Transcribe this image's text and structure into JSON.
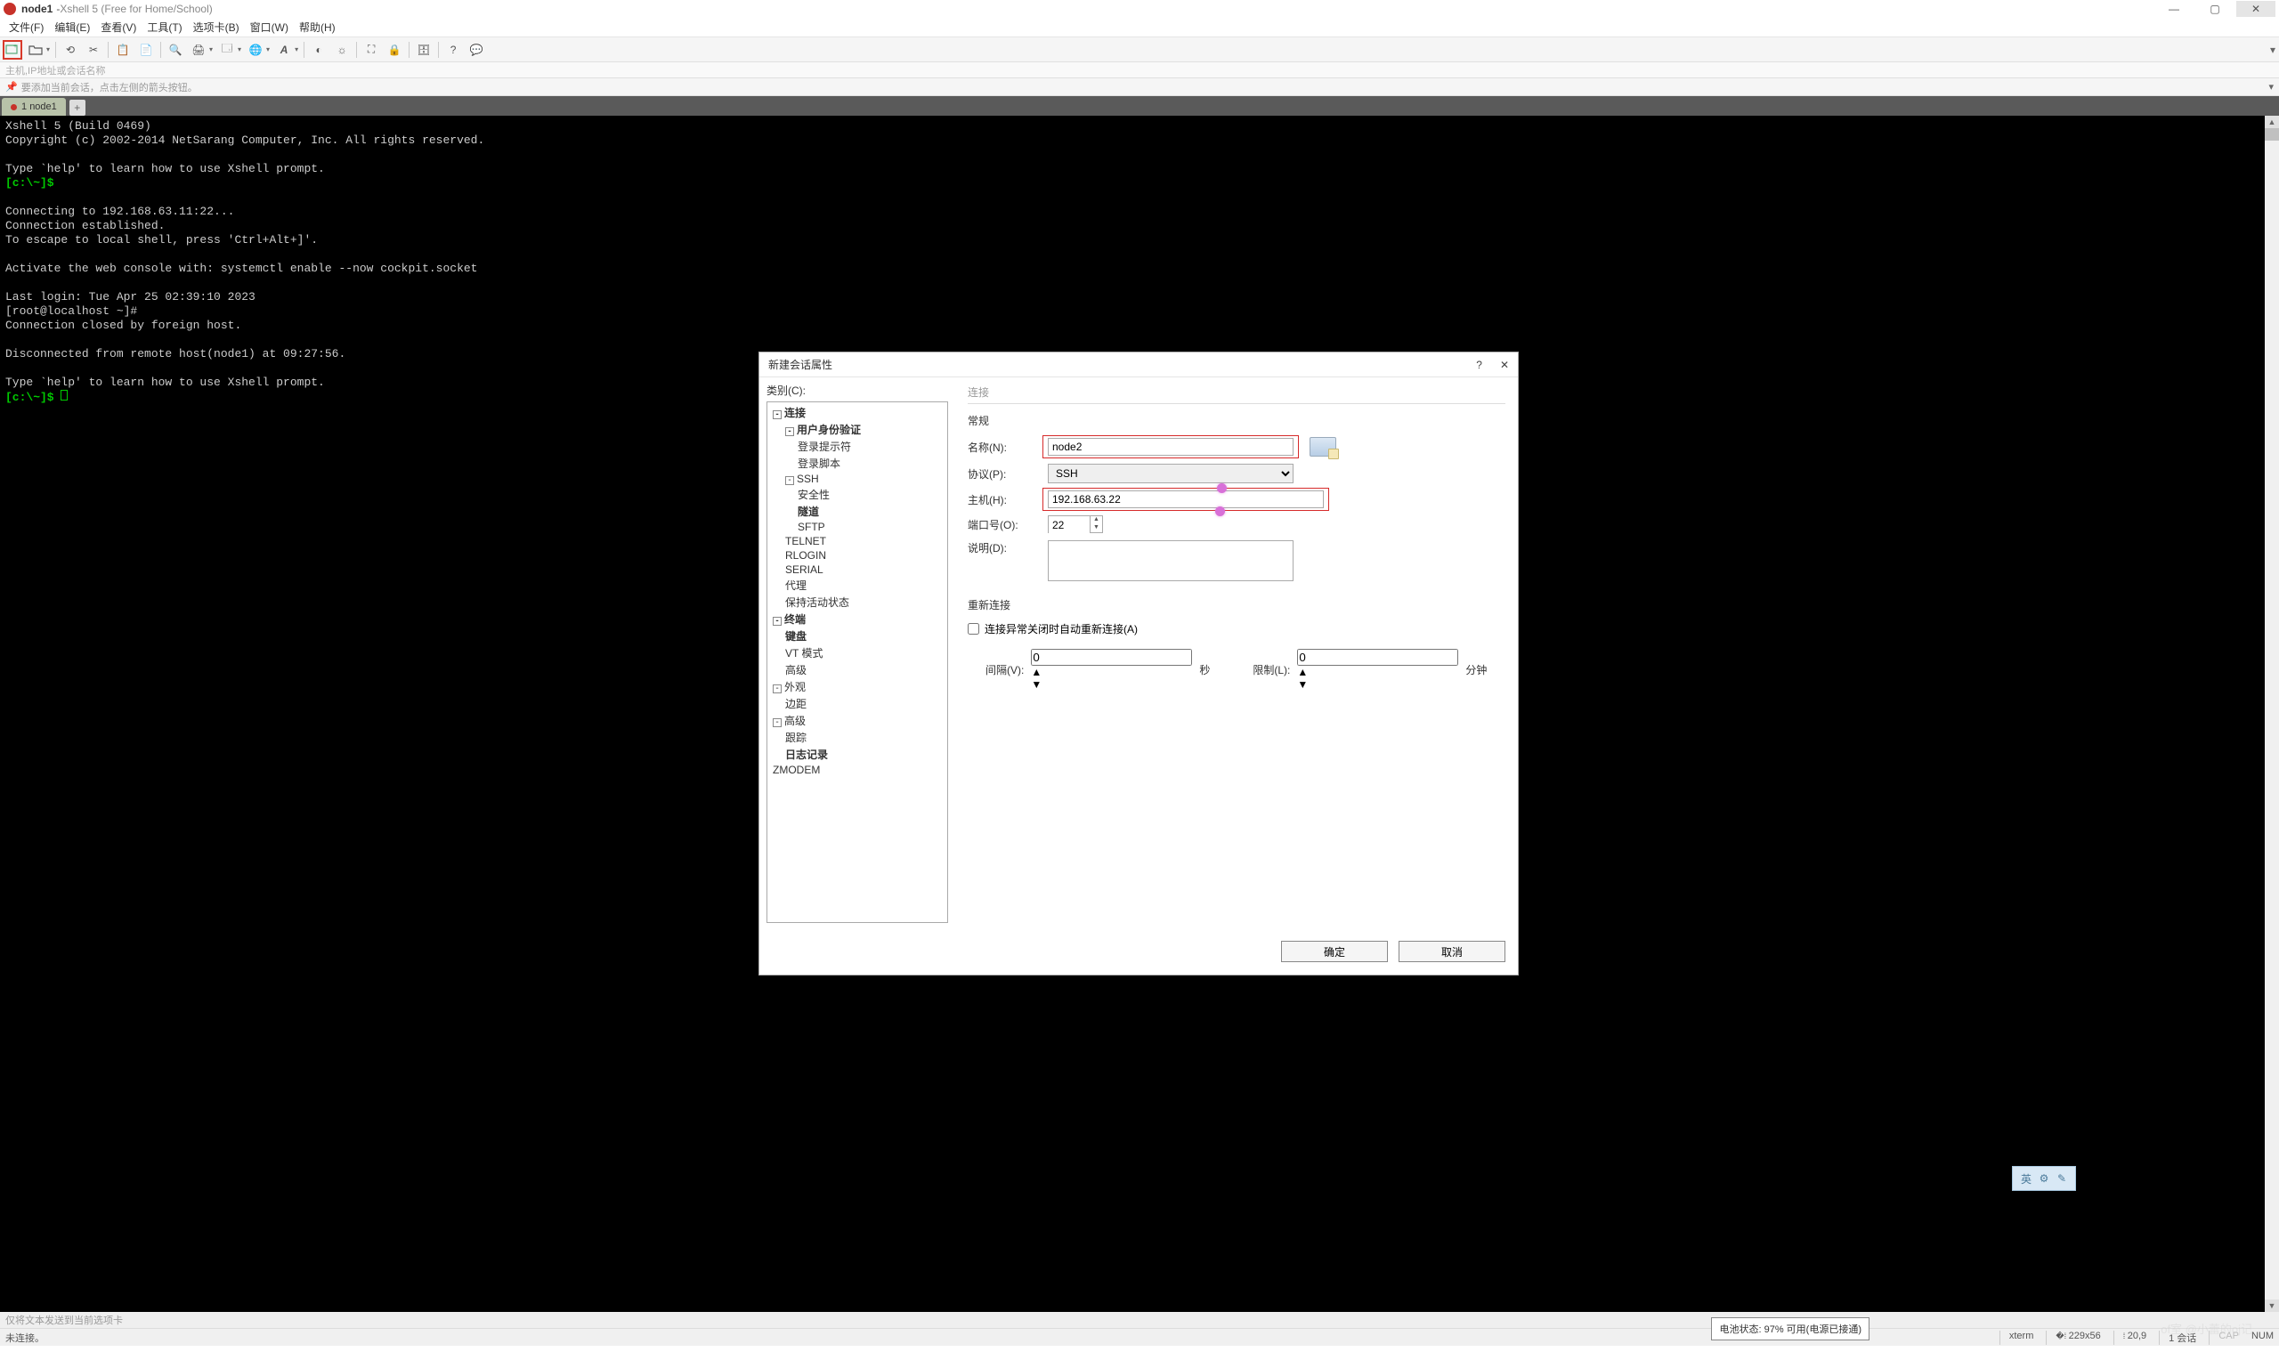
{
  "title": {
    "session": "node1",
    "app": "Xshell 5 (Free for Home/School)"
  },
  "menu": [
    "文件(F)",
    "编辑(E)",
    "查看(V)",
    "工具(T)",
    "选项卡(B)",
    "窗口(W)",
    "帮助(H)"
  ],
  "addressbar_placeholder": "主机,IP地址或会话名称",
  "quickbar_text": "要添加当前会话，点击左侧的箭头按钮。",
  "tab": {
    "index": "1",
    "name": "node1"
  },
  "terminal_lines": [
    "Xshell 5 (Build 0469)",
    "Copyright (c) 2002-2014 NetSarang Computer, Inc. All rights reserved.",
    "",
    "Type `help' to learn how to use Xshell prompt.",
    {
      "prompt": "[c:\\~]$ ",
      "rest": ""
    },
    "",
    "Connecting to 192.168.63.11:22...",
    "Connection established.",
    "To escape to local shell, press 'Ctrl+Alt+]'.",
    "",
    "Activate the web console with: systemctl enable --now cockpit.socket",
    "",
    "Last login: Tue Apr 25 02:39:10 2023",
    "[root@localhost ~]#",
    "Connection closed by foreign host.",
    "",
    "Disconnected from remote host(node1) at 09:27:56.",
    "",
    "Type `help' to learn how to use Xshell prompt.",
    {
      "prompt": "[c:\\~]$ ",
      "rest": "",
      "cursor": true
    }
  ],
  "dialog": {
    "title": "新建会话属性",
    "tree_label": "类别(C):",
    "tree": [
      {
        "l": 0,
        "b": true,
        "e": "-",
        "t": "连接"
      },
      {
        "l": 1,
        "b": true,
        "e": "-",
        "t": "用户身份验证"
      },
      {
        "l": 2,
        "t": "登录提示符"
      },
      {
        "l": 2,
        "t": "登录脚本"
      },
      {
        "l": 1,
        "e": "-",
        "t": "SSH"
      },
      {
        "l": 2,
        "t": "安全性"
      },
      {
        "l": 2,
        "b": true,
        "t": "隧道"
      },
      {
        "l": 2,
        "t": "SFTP"
      },
      {
        "l": 1,
        "t": "TELNET"
      },
      {
        "l": 1,
        "t": "RLOGIN"
      },
      {
        "l": 1,
        "t": "SERIAL"
      },
      {
        "l": 1,
        "t": "代理"
      },
      {
        "l": 1,
        "t": "保持活动状态"
      },
      {
        "l": 0,
        "b": true,
        "e": "-",
        "t": "终端"
      },
      {
        "l": 1,
        "b": true,
        "t": "键盘"
      },
      {
        "l": 1,
        "t": "VT 模式"
      },
      {
        "l": 1,
        "t": "高级"
      },
      {
        "l": 0,
        "e": "-",
        "t": "外观"
      },
      {
        "l": 1,
        "t": "边距"
      },
      {
        "l": 0,
        "e": "-",
        "t": "高级"
      },
      {
        "l": 1,
        "t": "跟踪"
      },
      {
        "l": 1,
        "b": true,
        "t": "日志记录"
      },
      {
        "l": 0,
        "t": "ZMODEM"
      }
    ],
    "tab_label": "连接",
    "section_general": "常规",
    "labels": {
      "name": "名称(N):",
      "protocol": "协议(P):",
      "host": "主机(H):",
      "port": "端口号(O):",
      "desc": "说明(D):"
    },
    "values": {
      "name": "node2",
      "protocol": "SSH",
      "host": "192.168.63.22",
      "port": "22",
      "desc": ""
    },
    "section_reconnect": "重新连接",
    "reconnect_checkbox": "连接异常关闭时自动重新连接(A)",
    "reconnect": {
      "interval_label": "间隔(V):",
      "interval_value": "0",
      "interval_unit": "秒",
      "limit_label": "限制(L):",
      "limit_value": "0",
      "limit_unit": "分钟"
    },
    "buttons": {
      "ok": "确定",
      "cancel": "取消"
    }
  },
  "hintbar": "仅将文本发送到当前选项卡",
  "battery_tooltip": "电池状态: 97% 可用(电源已接通)",
  "status": {
    "left": "未连接。",
    "xterm": "xterm",
    "size": "229x56",
    "pos": "20,9",
    "sess": "1 会话",
    "caps": "CAP",
    "num": "NUM"
  },
  "ime": [
    "英",
    "⚙",
    "✎"
  ],
  "watermark": "of室 @小蕾的oj记"
}
